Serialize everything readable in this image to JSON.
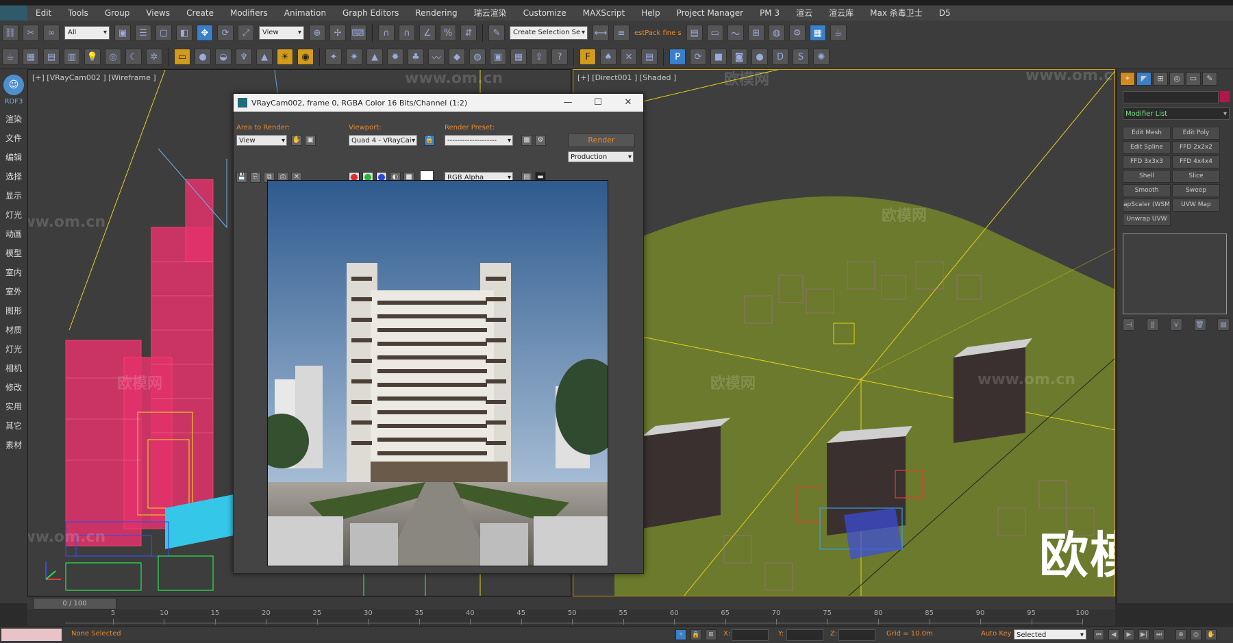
{
  "menu": [
    "Edit",
    "Tools",
    "Group",
    "Views",
    "Create",
    "Modifiers",
    "Animation",
    "Graph Editors",
    "Rendering",
    "瑞云渲染",
    "Customize",
    "MAXScript",
    "Help",
    "Project Manager",
    "PM 3",
    "渲云",
    "渲云库",
    "Max 杀毒卫士",
    "D5"
  ],
  "toolbar": {
    "selection_filter": "All",
    "ref_coord": "View",
    "named_selection": "Create Selection Se",
    "plugin_text": "estPack fine s"
  },
  "left_rail": {
    "logo_icon": "cat-icon",
    "title": "RDF3",
    "items": [
      "渲染",
      "文件",
      "编辑",
      "选择",
      "显示",
      "灯光",
      "动画",
      "模型",
      "室内",
      "室外",
      "图形",
      "材质",
      "灯光",
      "相机",
      "修改",
      "实用",
      "其它",
      "素材"
    ]
  },
  "viewport_left": {
    "label": "[+] [VRayCam002 ] [Wireframe ]"
  },
  "viewport_right": {
    "label": "[+] [Direct001 ] [Shaded ]"
  },
  "watermarks": {
    "site": "www.om.cn",
    "cn": "欧模网",
    "brand": "欧模网"
  },
  "render_window": {
    "title": "VRayCam002, frame 0, RGBA Color 16 Bits/Channel (1:2)",
    "area_label": "Area to Render:",
    "area_value": "View",
    "viewport_label": "Viewport:",
    "viewport_value": "Quad 4 - VRayCai",
    "preset_label": "Render Preset:",
    "preset_value": "--------------------",
    "render_button": "Render",
    "mode_value": "Production",
    "channel_value": "RGB Alpha"
  },
  "command_panel": {
    "modifier_list": "Modifier List",
    "modifiers": [
      "Edit Mesh",
      "Edit Poly",
      "Edit Spline",
      "FFD 2x2x2",
      "FFD 3x3x3",
      "FFD 4x4x4",
      "Shell",
      "Slice",
      "Smooth",
      "Sweep",
      "apScaler (WSM",
      "UVW Map",
      "Unwrap UVW"
    ],
    "selection_color": "#b0184d"
  },
  "timeline": {
    "frame": "0 / 100",
    "ticks": [
      "5",
      "10",
      "15",
      "20",
      "25",
      "30",
      "35",
      "40",
      "45",
      "50",
      "55",
      "60",
      "65",
      "70",
      "75",
      "80",
      "85",
      "90",
      "95",
      "100"
    ]
  },
  "status": {
    "selection_text": "None Selected",
    "x_label": "X:",
    "y_label": "Y:",
    "z_label": "Z:",
    "grid": "Grid = 10.0m",
    "auto_key": "Auto Key",
    "key_filter": "Selected"
  }
}
